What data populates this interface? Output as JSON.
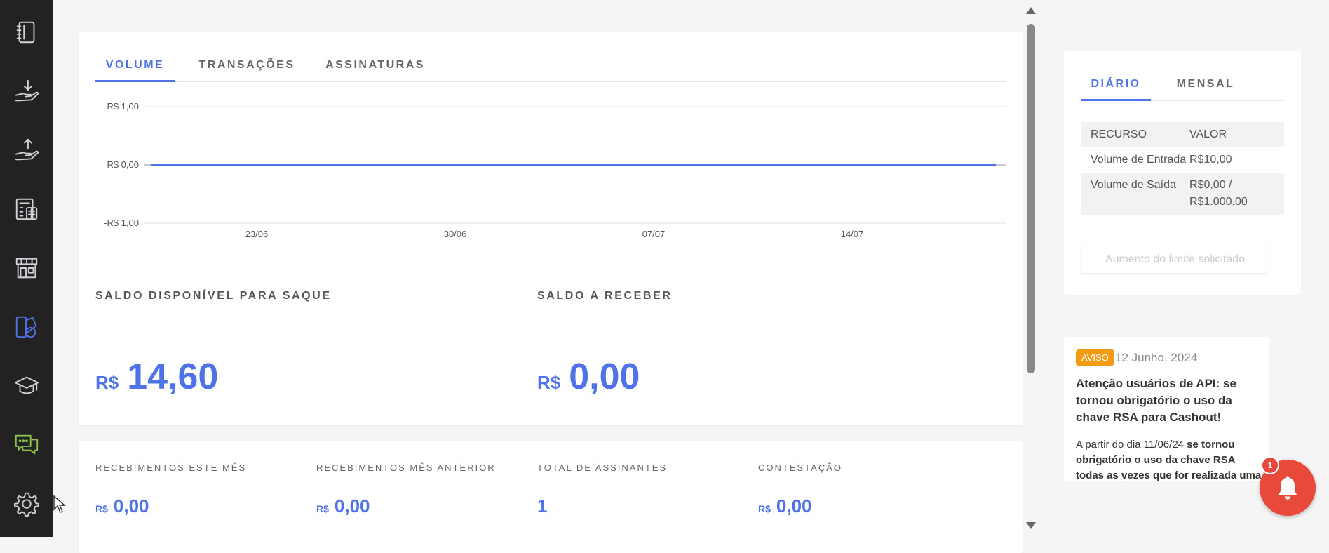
{
  "sidebar": {
    "items": [
      {
        "name": "notebook-icon"
      },
      {
        "name": "deposit-icon"
      },
      {
        "name": "withdraw-icon"
      },
      {
        "name": "calculator-icon"
      },
      {
        "name": "store-icon"
      },
      {
        "name": "dashboard-icon",
        "active": true
      },
      {
        "name": "graduation-cap-icon"
      },
      {
        "name": "chat-icon"
      },
      {
        "name": "settings-icon"
      }
    ]
  },
  "main": {
    "tabs": [
      {
        "label": "VOLUME",
        "active": true
      },
      {
        "label": "TRANSAÇÕES"
      },
      {
        "label": "ASSINATURAS"
      }
    ],
    "balance": {
      "available_label": "SALDO DISPONÍVEL PARA SAQUE",
      "available_currency": "R$",
      "available_value": "14,60",
      "receivable_label": "SALDO A RECEBER",
      "receivable_currency": "R$",
      "receivable_value": "0,00"
    },
    "stats": [
      {
        "label": "RECEBIMENTOS ESTE MÊS",
        "currency": "R$",
        "value": "0,00"
      },
      {
        "label": "RECEBIMENTOS MÊS ANTERIOR",
        "currency": "R$",
        "value": "0,00"
      },
      {
        "label": "TOTAL DE ASSINANTES",
        "currency": "",
        "value": "1"
      },
      {
        "label": "CONTESTAÇÃO",
        "currency": "R$",
        "value": "0,00"
      }
    ]
  },
  "chart_data": {
    "type": "line",
    "y_tick_labels": [
      "R$ 1,00",
      "R$ 0,00",
      "-R$ 1,00"
    ],
    "ylim": [
      -1,
      1
    ],
    "x_tick_labels": [
      "23/06",
      "30/06",
      "07/07",
      "14/07"
    ],
    "series": [
      {
        "values": [
          0,
          0,
          0,
          0,
          0,
          0,
          0,
          0,
          0,
          0,
          0,
          0,
          0,
          0,
          0,
          0,
          0,
          0,
          0,
          0,
          0,
          0,
          0,
          0,
          0,
          0,
          0,
          0,
          0,
          0
        ]
      }
    ],
    "grid": true,
    "colors": {
      "line": "#4f72e8"
    }
  },
  "limits": {
    "tabs": [
      {
        "label": "DIÁRIO",
        "active": true
      },
      {
        "label": "MENSAL"
      }
    ],
    "header": {
      "resource": "RECURSO",
      "value": "VALOR"
    },
    "rows": [
      {
        "resource": "Volume de Entrada",
        "value": "R$10,00"
      },
      {
        "resource": "Volume de Saída",
        "value": "R$0,00 / R$1.000,00"
      }
    ],
    "button_label": "Aumento do limite solicitado"
  },
  "notice": {
    "badge": "AVISO",
    "date": "12 Junho, 2024",
    "title": "Atenção usuários de API: se tornou obrigatório o uso da chave RSA para Cashout!",
    "body_prefix": "A partir do dia 11/06/24 ",
    "body_bold": "se tornou obrigatório o uso da chave RSA todas as vezes que for realizada uma"
  },
  "notifications": {
    "count": "1"
  },
  "colors": {
    "accent": "#4f72e8",
    "warning": "#f39c12",
    "alert": "#e8493b",
    "sidebar": "#222222"
  }
}
